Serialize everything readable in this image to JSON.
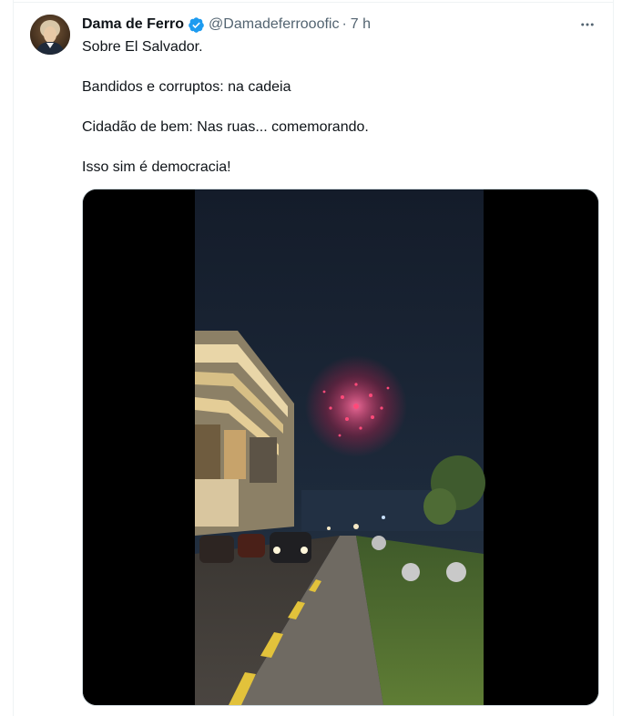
{
  "tweet": {
    "author": {
      "display_name": "Dama de Ferro",
      "handle": "@Damadeferrooofic",
      "verified": true,
      "avatar_icon": "avatar-portrait-icon"
    },
    "separator": "·",
    "time": "7 h",
    "more_icon": "more-horizontal-icon",
    "lines": [
      "Sobre El Salvador.",
      "Bandidos e corruptos: na cadeia",
      "Cidadão de bem: Nas ruas... comemorando.",
      "Isso sim é democracia!"
    ],
    "media": {
      "type": "video",
      "scene_icon": "fireworks-street-video-frame"
    }
  },
  "colors": {
    "text_primary": "#0f1419",
    "text_secondary": "#536471",
    "verified_blue": "#1d9bf0",
    "border": "#cfd9de"
  }
}
